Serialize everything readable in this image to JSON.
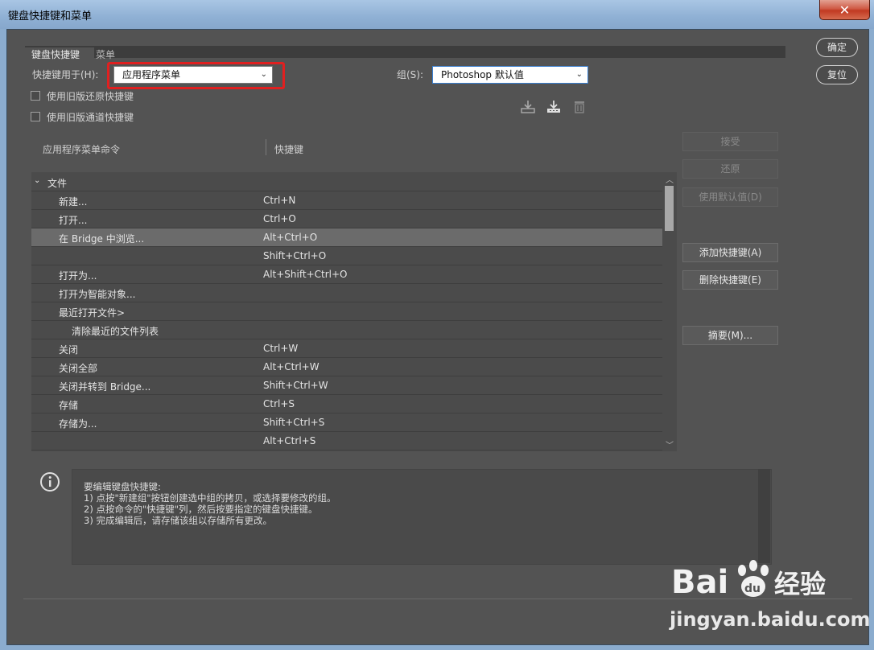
{
  "window": {
    "title": "键盘快捷键和菜单",
    "close_glyph": "✕"
  },
  "tabs": [
    {
      "label": "键盘快捷键"
    },
    {
      "label": "菜单"
    }
  ],
  "shortcuts_for": {
    "label": "快捷键用于(H):",
    "value": "应用程序菜单"
  },
  "group": {
    "label": "组(S):",
    "value": "Photoshop 默认值"
  },
  "options": {
    "legacy_undo": "使用旧版还原快捷键",
    "legacy_channel": "使用旧版通道快捷键"
  },
  "icons": [
    "save-set-icon",
    "new-set-icon",
    "trash-icon",
    "info-icon"
  ],
  "table": {
    "col_command": "应用程序菜单命令",
    "col_shortcut": "快捷键",
    "rows": [
      {
        "cmd": "文件",
        "key": "",
        "level": 0,
        "expanded": true
      },
      {
        "cmd": "新建...",
        "key": "Ctrl+N",
        "level": 1
      },
      {
        "cmd": "打开...",
        "key": "Ctrl+O",
        "level": 1
      },
      {
        "cmd": "在 Bridge 中浏览...",
        "key": "Alt+Ctrl+O",
        "level": 1,
        "selected": true
      },
      {
        "cmd": "",
        "key": "Shift+Ctrl+O",
        "level": 1
      },
      {
        "cmd": "打开为...",
        "key": "Alt+Shift+Ctrl+O",
        "level": 1
      },
      {
        "cmd": "打开为智能对象...",
        "key": "",
        "level": 1
      },
      {
        "cmd": "最近打开文件>",
        "key": "",
        "level": 1
      },
      {
        "cmd": "清除最近的文件列表",
        "key": "",
        "level": 2
      },
      {
        "cmd": "关闭",
        "key": "Ctrl+W",
        "level": 1
      },
      {
        "cmd": "关闭全部",
        "key": "Alt+Ctrl+W",
        "level": 1
      },
      {
        "cmd": "关闭并转到 Bridge...",
        "key": "Shift+Ctrl+W",
        "level": 1
      },
      {
        "cmd": "存储",
        "key": "Ctrl+S",
        "level": 1
      },
      {
        "cmd": "存储为...",
        "key": "Shift+Ctrl+S",
        "level": 1
      },
      {
        "cmd": "",
        "key": "Alt+Ctrl+S",
        "level": 1
      }
    ]
  },
  "buttons": {
    "ok": "确定",
    "reset": "复位",
    "accept": "接受",
    "undo": "还原",
    "use_default": "使用默认值(D)",
    "add_shortcut": "添加快捷键(A)",
    "delete_shortcut": "删除快捷键(E)",
    "summary": "摘要(M)..."
  },
  "info": {
    "lines": [
      "要编辑键盘快捷键:",
      "1) 点按\"新建组\"按钮创建选中组的拷贝，或选择要修改的组。",
      "2) 点按命令的\"快捷键\"列，然后按要指定的键盘快捷键。",
      "3) 完成编辑后，请存储该组以存储所有更改。"
    ]
  },
  "watermark": {
    "logo": "Bai du 经验",
    "url": "jingyan.baidu.com"
  },
  "colors": {
    "panel_bg": "#535353",
    "highlight": "#e02020",
    "selected_row": "#6b6b6b"
  }
}
